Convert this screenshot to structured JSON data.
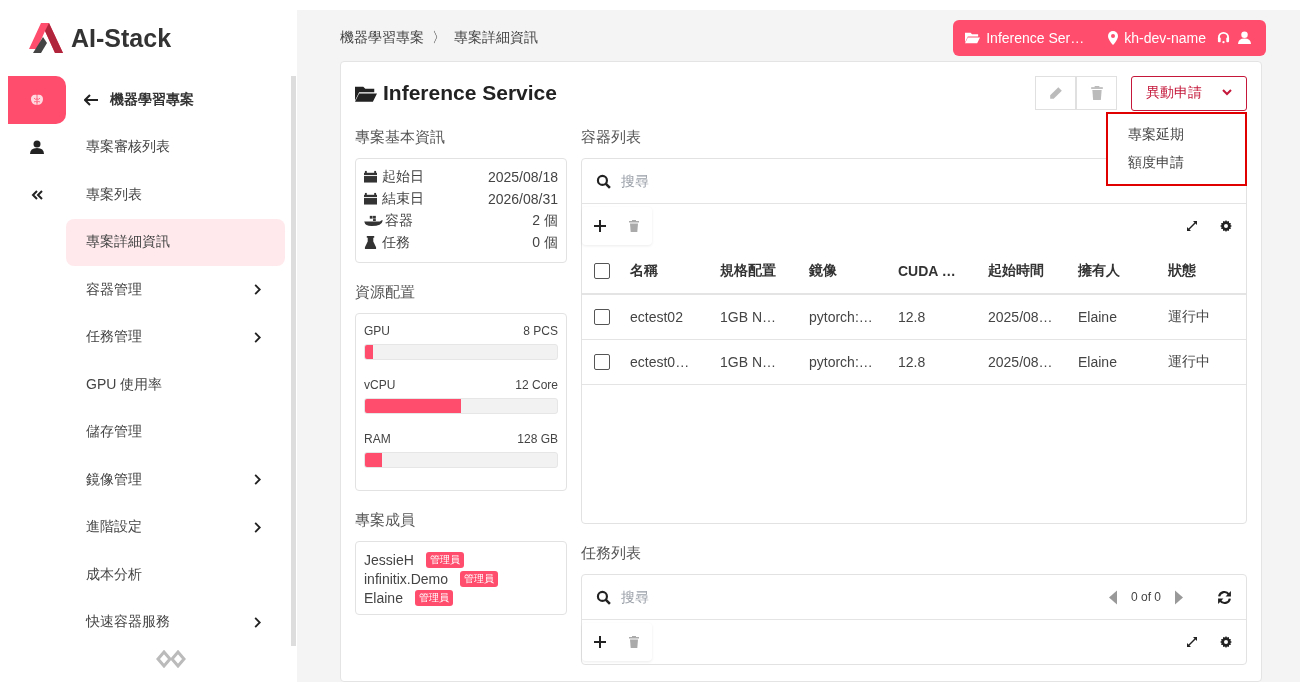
{
  "logo": {
    "text": "AI-Stack"
  },
  "rail": [
    {
      "selected": true
    },
    {
      "selected": false
    },
    {
      "selected": false
    }
  ],
  "sidebar": {
    "back": {
      "label": "機器學習專案"
    },
    "items": [
      {
        "label": "專案審核列表",
        "selected": false,
        "has_submenu": false
      },
      {
        "label": "專案列表",
        "selected": false,
        "has_submenu": false
      },
      {
        "label": "專案詳細資訊",
        "selected": true,
        "has_submenu": false
      },
      {
        "label": "容器管理",
        "selected": false,
        "has_submenu": true
      },
      {
        "label": "任務管理",
        "selected": false,
        "has_submenu": true
      },
      {
        "label": "GPU 使用率",
        "selected": false,
        "has_submenu": false
      },
      {
        "label": "儲存管理",
        "selected": false,
        "has_submenu": false
      },
      {
        "label": "鏡像管理",
        "selected": false,
        "has_submenu": true
      },
      {
        "label": "進階設定",
        "selected": false,
        "has_submenu": true
      },
      {
        "label": "成本分析",
        "selected": false,
        "has_submenu": false
      },
      {
        "label": "快速容器服務",
        "selected": false,
        "has_submenu": true
      }
    ]
  },
  "breadcrumb": [
    {
      "label": "機器學習專案"
    },
    {
      "label": "〉"
    },
    {
      "label": "專案詳細資訊"
    }
  ],
  "topbar": {
    "project": "Inference Ser…",
    "location": "kh-dev-name"
  },
  "card": {
    "title": "Inference Service",
    "action": "異動申請",
    "menu": [
      {
        "label": "專案延期"
      },
      {
        "label": "額度申請"
      }
    ]
  },
  "basic_info": {
    "title": "專案基本資訊",
    "rows": [
      {
        "kind": "date",
        "label": "起始日",
        "value": "2025/08/18"
      },
      {
        "kind": "date",
        "label": "結束日",
        "value": "2026/08/31"
      },
      {
        "kind": "container",
        "label": "容器",
        "value": "2 個"
      },
      {
        "kind": "task",
        "label": "任務",
        "value": "0 個"
      }
    ]
  },
  "resources": {
    "title": "資源配置",
    "items": [
      {
        "name": "GPU",
        "reading": "8 PCS",
        "level": 0.04
      },
      {
        "name": "vCPU",
        "reading": "12 Core",
        "level": 0.5
      },
      {
        "name": "RAM",
        "reading": "128 GB",
        "level": 0.09
      }
    ]
  },
  "members": {
    "title": "專案成員",
    "items": [
      {
        "name": "JessieH",
        "role": "管理員"
      },
      {
        "name": "infinitix.Demo",
        "role": "管理員"
      },
      {
        "name": "Elaine",
        "role": "管理員"
      }
    ]
  },
  "containers": {
    "title": "容器列表",
    "search_placeholder": "搜尋",
    "columns": [
      "名稱",
      "規格配置",
      "鏡像",
      "CUDA …",
      "起始時間",
      "擁有人",
      "狀態"
    ],
    "all_checked": false,
    "rows": [
      {
        "checked": false,
        "cells": [
          "ectest02",
          "1GB N…",
          "pytorch:…",
          "12.8",
          "2025/08…",
          "Elaine",
          "運行中"
        ]
      },
      {
        "checked": false,
        "cells": [
          "ectest0…",
          "1GB N…",
          "pytorch:…",
          "12.8",
          "2025/08…",
          "Elaine",
          "運行中"
        ]
      }
    ]
  },
  "tasks": {
    "title": "任務列表",
    "search_placeholder": "搜尋",
    "pagination": "0 of 0"
  }
}
